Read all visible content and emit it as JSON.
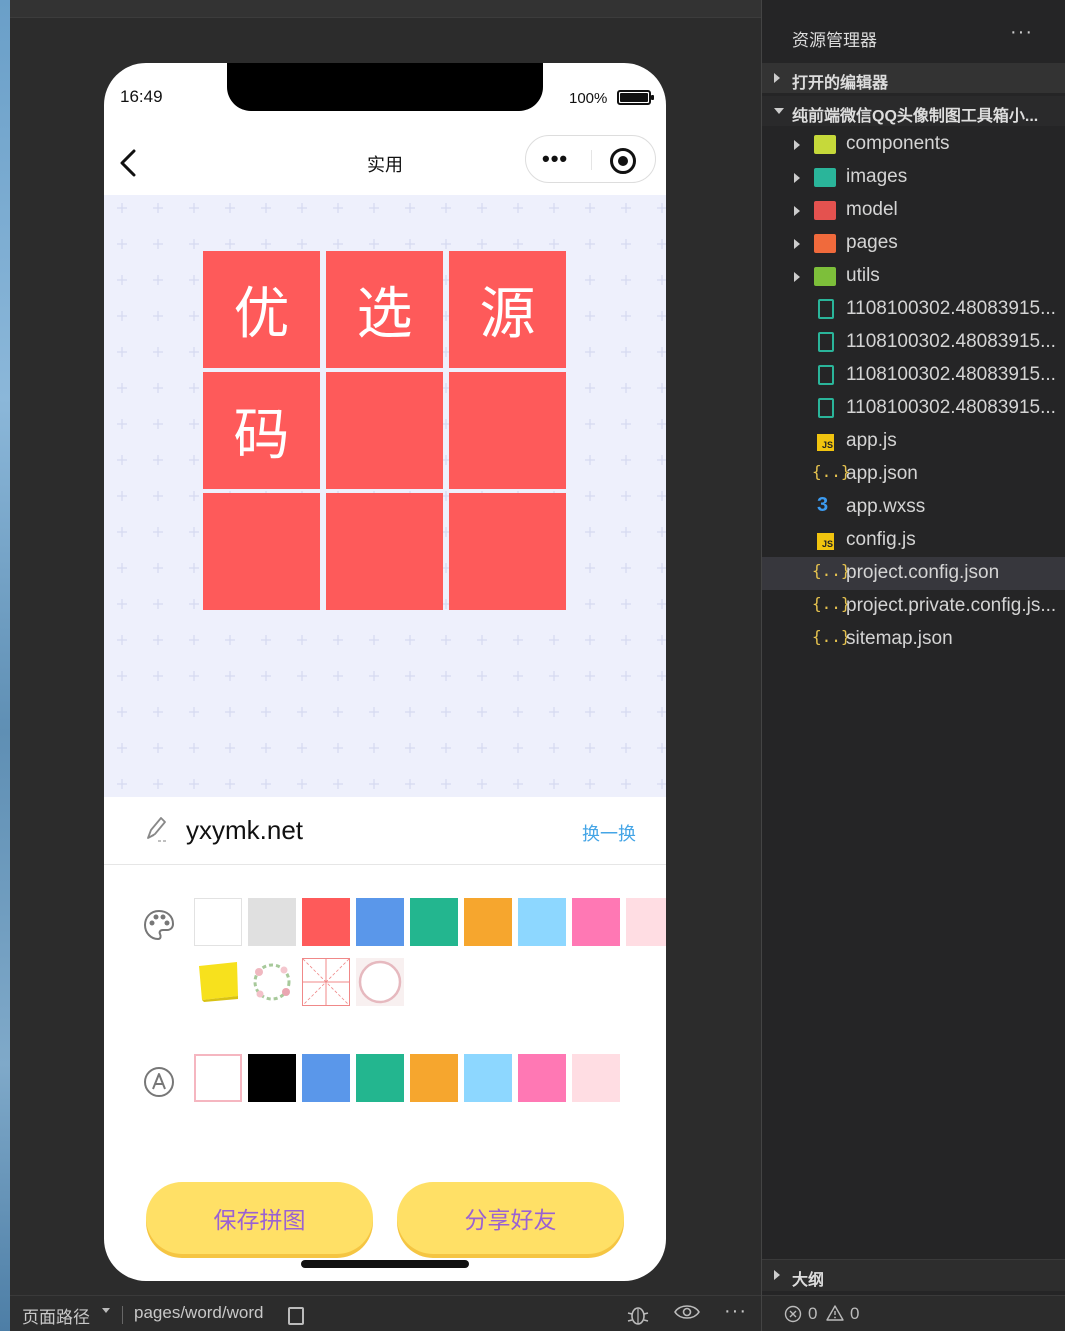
{
  "simulator": {
    "status_time": "16:49",
    "battery_pct": "100%",
    "nav_title": "实用",
    "capsule_more": "•••",
    "grid_chars": [
      "优",
      "选",
      "源",
      "码",
      "",
      "",
      "",
      "",
      ""
    ],
    "grid_color": "#fe5a5a",
    "input_text": "yxymk.net",
    "shuffle_label": "换一换",
    "bg_colors": [
      "#ffffff",
      "#e0e0e0",
      "#fe5a5a",
      "#5a97ea",
      "#23b68f",
      "#f6a62e",
      "#8dd7ff",
      "#ff78b4",
      "#ffdde3"
    ],
    "bg_patterns": [
      "sticky-note",
      "flower-wreath",
      "grid-paper",
      "circle-frame"
    ],
    "text_colors": [
      "#ffffff",
      "#000000",
      "#5a97ea",
      "#23b68f",
      "#f6a62e",
      "#8dd7ff",
      "#ff78b4",
      "#ffdde3"
    ],
    "save_button": "保存拼图",
    "share_button": "分享好友"
  },
  "bottom_bar": {
    "path_label": "页面路径",
    "path_value": "pages/word/word"
  },
  "explorer": {
    "title": "资源管理器",
    "more": "···",
    "open_editors": "打开的编辑器",
    "project_name": "纯前端微信QQ头像制图工具箱小...",
    "folders": [
      {
        "label": "components",
        "color": "#c6d93a"
      },
      {
        "label": "images",
        "color": "#2ab59a"
      },
      {
        "label": "model",
        "color": "#e4524f"
      },
      {
        "label": "pages",
        "color": "#f06a3c"
      },
      {
        "label": "utils",
        "color": "#7dbf3a"
      }
    ],
    "files": [
      {
        "label": "1108100302.48083915...",
        "icon": "image-file-icon"
      },
      {
        "label": "1108100302.48083915...",
        "icon": "image-file-icon"
      },
      {
        "label": "1108100302.48083915...",
        "icon": "image-file-icon"
      },
      {
        "label": "1108100302.48083915...",
        "icon": "image-file-icon"
      },
      {
        "label": "app.js",
        "icon": "js-file-icon"
      },
      {
        "label": "app.json",
        "icon": "json-file-icon"
      },
      {
        "label": "app.wxss",
        "icon": "css-file-icon"
      },
      {
        "label": "config.js",
        "icon": "js-file-icon"
      },
      {
        "label": "project.config.json",
        "icon": "json-file-icon"
      },
      {
        "label": "project.private.config.js...",
        "icon": "json-file-icon"
      },
      {
        "label": "sitemap.json",
        "icon": "json-file-icon"
      }
    ],
    "outline": "大纲",
    "errors": "0",
    "warnings": "0"
  }
}
